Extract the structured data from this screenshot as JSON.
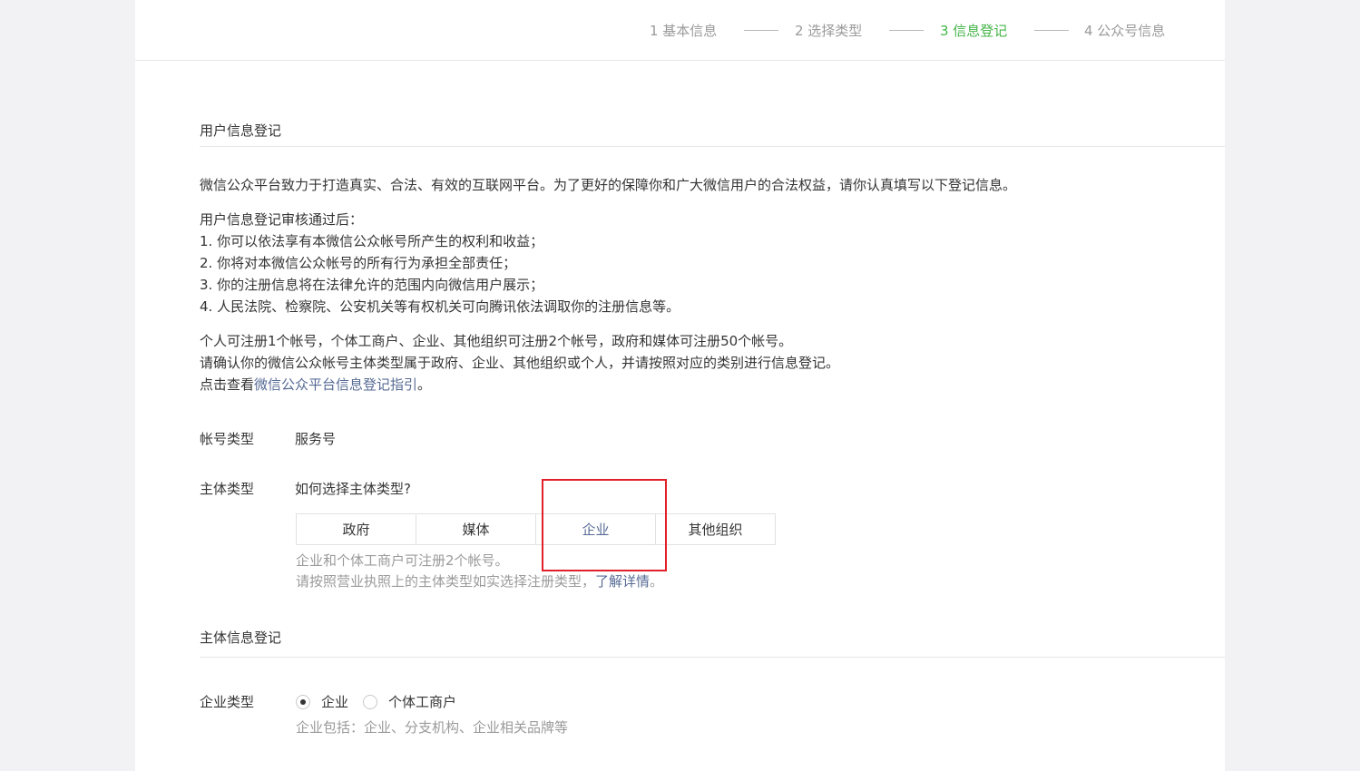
{
  "steps": [
    {
      "label": "1 基本信息",
      "active": false
    },
    {
      "label": "2 选择类型",
      "active": false
    },
    {
      "label": "3 信息登记",
      "active": true
    },
    {
      "label": "4 公众号信息",
      "active": false
    }
  ],
  "user_info": {
    "title": "用户信息登记",
    "intro": "微信公众平台致力于打造真实、合法、有效的互联网平台。为了更好的保障你和广大微信用户的合法权益，请你认真填写以下登记信息。",
    "after_review_heading": "用户信息登记审核通过后：",
    "items": [
      "1. 你可以依法享有本微信公众帐号所产生的权利和收益；",
      "2. 你将对本微信公众帐号的所有行为承担全部责任；",
      "3. 你的注册信息将在法律允许的范围内向微信用户展示；",
      "4. 人民法院、检察院、公安机关等有权机关可向腾讯依法调取你的注册信息等。"
    ],
    "quota_text": "个人可注册1个帐号，个体工商户、企业、其他组织可注册2个帐号，政府和媒体可注册50个帐号。",
    "confirm_text": "请确认你的微信公众帐号主体类型属于政府、企业、其他组织或个人，并请按照对应的类别进行信息登记。",
    "guide_prefix": "点击查看",
    "guide_link": "微信公众平台信息登记指引",
    "guide_suffix": "。"
  },
  "account_type": {
    "label": "帐号类型",
    "value": "服务号"
  },
  "subject_type": {
    "label": "主体类型",
    "help_link": "如何选择主体类型?",
    "options": [
      "政府",
      "媒体",
      "企业",
      "其他组织"
    ],
    "selected": "企业",
    "hint1": "企业和个体工商户可注册2个帐号。",
    "hint2_prefix": "请按照营业执照上的主体类型如实选择注册类型，",
    "hint2_link": "了解详情",
    "hint2_suffix": "。"
  },
  "subject_info": {
    "title": "主体信息登记",
    "enterprise_type_label": "企业类型",
    "radio_options": [
      "企业",
      "个体工商户"
    ],
    "radio_selected": "企业",
    "hint": "企业包括：企业、分支机构、企业相关品牌等"
  },
  "colors": {
    "accent_green": "#44b549",
    "link_blue": "#576b95",
    "highlight_red": "#e0202a"
  }
}
